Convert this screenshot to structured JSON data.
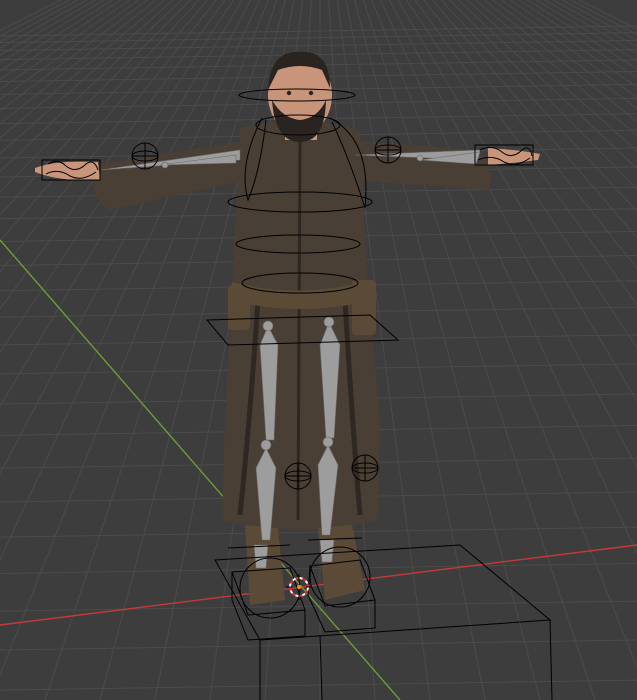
{
  "viewport": {
    "name": "3D Viewport",
    "background": "#3d3d3d",
    "grid_color": "#4b4b4b",
    "x_axis_color": "#c43a3a",
    "y_axis_color": "#6f9a3a",
    "wire_color": "#000000",
    "bone_color": "#9d9d9d",
    "selected_color": "#ff8c1a",
    "cursor_icon": "3d-cursor-icon"
  },
  "character": {
    "robe_color": "#4a3f35",
    "robe_shadow": "#2f2822",
    "skin_color": "#c9957a",
    "hair_color": "#2a2420",
    "belt_color": "#5b4a36"
  }
}
